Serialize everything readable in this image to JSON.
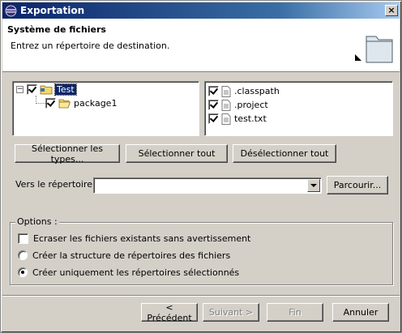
{
  "window": {
    "title": "Exportation",
    "close_label": "×"
  },
  "banner": {
    "title": "Système de fichiers",
    "description": "Entrez un répertoire de destination."
  },
  "tree": {
    "root": {
      "label": "Test",
      "checked": true,
      "expanded": true,
      "selected": true,
      "expander": "−"
    },
    "child": {
      "label": "package1",
      "checked": true
    }
  },
  "files": [
    {
      "label": ".classpath",
      "checked": true
    },
    {
      "label": ".project",
      "checked": true
    },
    {
      "label": "test.txt",
      "checked": true
    }
  ],
  "selection_buttons": {
    "select_types": "Sélectionner les types...",
    "select_all": "Sélectionner tout",
    "deselect_all": "Désélectionner tout"
  },
  "directory": {
    "label": "Vers le répertoire :",
    "value": "",
    "browse": "Parcourir..."
  },
  "options": {
    "title": "Options :",
    "overwrite": {
      "label": "Ecraser les fichiers existants sans avertissement",
      "checked": false
    },
    "create_structure": {
      "label": "Créer la structure de répertoires des fichiers",
      "selected": false
    },
    "create_selected_only": {
      "label": "Créer uniquement les répertoires sélectionnés",
      "selected": true
    }
  },
  "footer": {
    "back": "< Précédent",
    "next": "Suivant >",
    "finish": "Fin",
    "cancel": "Annuler",
    "next_enabled": false,
    "finish_enabled": false
  },
  "colors": {
    "titlebar_start": "#0a246a",
    "titlebar_end": "#a6caf0",
    "face": "#d4d0c8",
    "selection": "#0a246a"
  }
}
